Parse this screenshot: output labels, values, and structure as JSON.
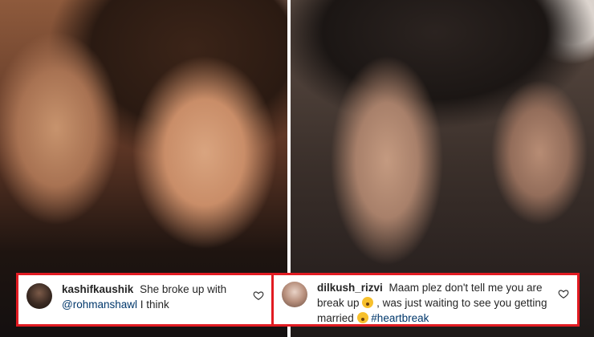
{
  "comments": [
    {
      "username": "kashifkaushik",
      "text_before": "She broke up with",
      "mention": "@rohmanshawl",
      "text_after": "I think",
      "avatar_icon": "avatar-photo",
      "like_icon": "heart-outline-icon"
    },
    {
      "username": "dilkush_rizvi",
      "text_part1": "Maam plez don't tell me you are break up",
      "emoji1": "surprised-face-emoji",
      "text_part2": ", was just waiting to see you getting married",
      "emoji2": "sad-face-emoji",
      "hashtag": "#heartbreak",
      "avatar_icon": "avatar-photo",
      "like_icon": "heart-outline-icon"
    }
  ],
  "colors": {
    "highlight_border": "#e11b22",
    "link": "#00376b",
    "text": "#262626"
  }
}
